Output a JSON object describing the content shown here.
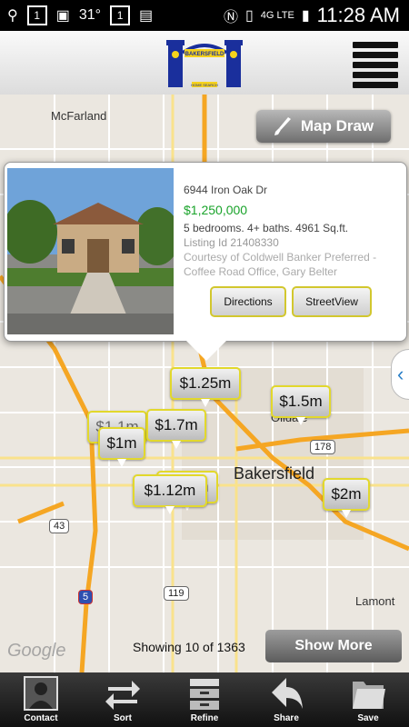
{
  "status_bar": {
    "temperature": "31°",
    "badge_1": "1",
    "badge_2": "1",
    "network": "4G LTE",
    "time": "11:28 AM"
  },
  "header": {
    "logo_text": "BAKERSFIELD",
    "logo_subtext": "HOME SEARCH"
  },
  "map": {
    "map_draw_label": "Map Draw",
    "labels": {
      "mcfarland": "McFarland",
      "oildale": "Oildale",
      "bakersfield": "Bakersfield",
      "lamont": "Lamont"
    },
    "shields": {
      "r99": "99",
      "r178": "178",
      "r43": "43",
      "r5": "5",
      "r119": "119"
    },
    "attribution": "Google"
  },
  "popup": {
    "address": "6944 Iron Oak Dr",
    "price": "$1,250,000",
    "details": "5 bedrooms. 4+ baths. 4961 Sq.ft.",
    "listing_id": "Listing Id 21408330",
    "courtesy": "Courtesy of Coldwell Banker Preferred - Coffee Road Office, Gary Belter",
    "directions_label": "Directions",
    "streetview_label": "StreetView"
  },
  "price_pins": [
    {
      "label": "$1.25m"
    },
    {
      "label": "$1.5m"
    },
    {
      "label": "$1.1m"
    },
    {
      "label": "$1m"
    },
    {
      "label": "$1.7m"
    },
    {
      "label": "$2.2m"
    },
    {
      "label": "$1.12m"
    },
    {
      "label": "$2m"
    }
  ],
  "results": {
    "showing_text": "Showing 10 of 1363",
    "show_more_label": "Show More"
  },
  "bottom_nav": [
    {
      "label": "Contact",
      "icon": "contact-icon"
    },
    {
      "label": "Sort",
      "icon": "sort-icon"
    },
    {
      "label": "Refine",
      "icon": "refine-icon"
    },
    {
      "label": "Share",
      "icon": "share-icon"
    },
    {
      "label": "Save",
      "icon": "save-icon"
    }
  ],
  "colors": {
    "price_green": "#19a32a",
    "pin_border": "#e2d82c",
    "highway": "#f5a623"
  }
}
